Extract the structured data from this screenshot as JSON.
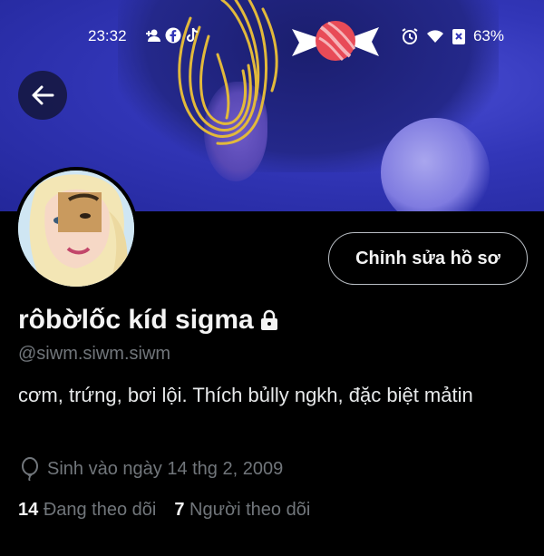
{
  "status_bar": {
    "time": "23:32",
    "battery": "63%",
    "left_icons": [
      "person-add-icon",
      "facebook-icon",
      "tiktok-icon"
    ],
    "right_icons": [
      "alarm-icon",
      "wifi-icon",
      "battery-saver-icon"
    ]
  },
  "header": {
    "back_icon": "arrow-left-icon"
  },
  "profile": {
    "edit_label": "Chỉnh sửa hồ sơ",
    "display_name": "rôbờlốc kíd sigma",
    "handle": "@siwm.siwm.siwm",
    "bio": "cơm, trứng, bơi lội. Thích bủlly ngkh, đặc biệt mảtin",
    "birth": "Sinh vào ngày 14 thg 2, 2009",
    "following_count": "14",
    "following_label": "Đang theo dõi",
    "followers_count": "7",
    "followers_label": "Người theo dõi"
  },
  "colors": {
    "background": "#000000",
    "banner": "#3236b8",
    "secondary_text": "#71767b",
    "scribble": "#e2b93b"
  }
}
